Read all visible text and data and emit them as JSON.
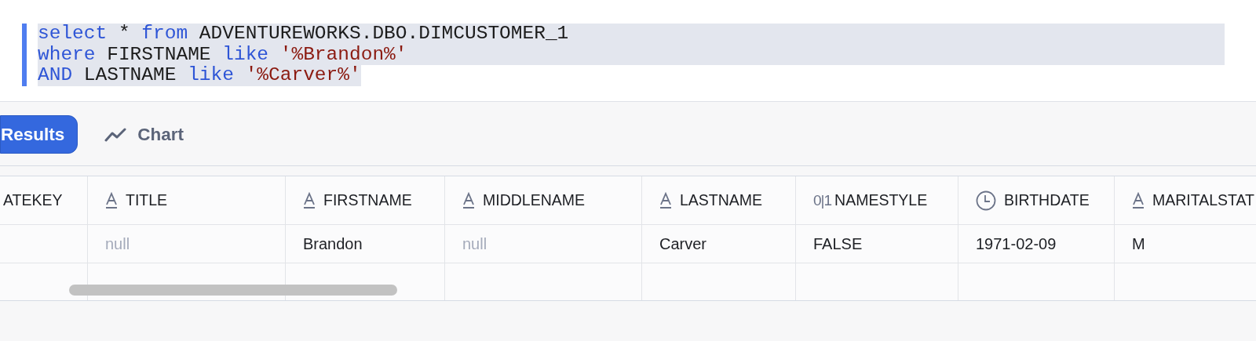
{
  "editor": {
    "lines": [
      {
        "selected": true,
        "tokens": [
          {
            "kind": "keyword",
            "text": "select"
          },
          {
            "kind": "plain",
            "text": " * "
          },
          {
            "kind": "keyword",
            "text": "from"
          },
          {
            "kind": "plain",
            "text": " ADVENTUREWORKS.DBO.DIMCUSTOMER_1"
          }
        ]
      },
      {
        "selected": true,
        "tokens": [
          {
            "kind": "keyword",
            "text": "where"
          },
          {
            "kind": "plain",
            "text": " FIRSTNAME "
          },
          {
            "kind": "keyword",
            "text": "like"
          },
          {
            "kind": "string",
            "text": " '%Brandon%'"
          }
        ]
      },
      {
        "selected": true,
        "tokens": [
          {
            "kind": "keyword",
            "text": "AND"
          },
          {
            "kind": "plain",
            "text": " LASTNAME "
          },
          {
            "kind": "keyword",
            "text": "like"
          },
          {
            "kind": "string",
            "text": " '%Carver%'"
          }
        ]
      }
    ]
  },
  "tabs": [
    {
      "label": "Results",
      "selected": true
    },
    {
      "label": "Chart",
      "selected": false
    }
  ],
  "table": {
    "columns": [
      {
        "name": "ATEKEY",
        "kind": "none"
      },
      {
        "name": "TITLE",
        "kind": "text"
      },
      {
        "name": "FIRSTNAME",
        "kind": "text"
      },
      {
        "name": "MIDDLENAME",
        "kind": "text"
      },
      {
        "name": "LASTNAME",
        "kind": "text"
      },
      {
        "name": "NAMESTYLE",
        "kind": "boolean",
        "icon_text": "0|1"
      },
      {
        "name": "BIRTHDATE",
        "kind": "date"
      },
      {
        "name": "MARITALSTAT",
        "kind": "text"
      }
    ],
    "rows": [
      {
        "cells": [
          {},
          {
            "text": "null",
            "null": true
          },
          {
            "text": "Brandon",
            "null": false
          },
          {
            "text": "null",
            "null": true
          },
          {
            "text": "Carver",
            "null": false
          },
          {
            "text": "FALSE",
            "null": false
          },
          {
            "text": "1971-02-09",
            "null": false
          },
          {
            "text": "M",
            "null": false
          }
        ]
      }
    ]
  }
}
